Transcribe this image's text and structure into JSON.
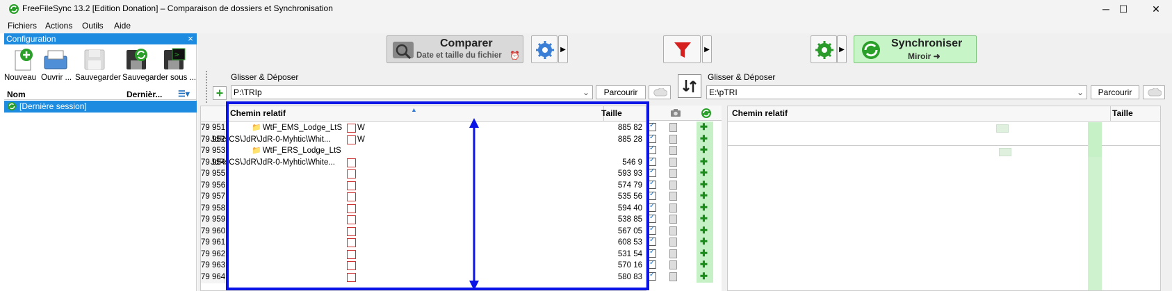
{
  "window": {
    "title": "FreeFileSync 13.2 [Edition Donation] – Comparaison de dossiers et Synchronisation",
    "minimize": "─",
    "maximize": "☐",
    "close": "✕"
  },
  "menu": [
    "Fichiers",
    "Actions",
    "Outils",
    "Aide"
  ],
  "config": {
    "title": "Configuration",
    "close": "×",
    "toolbar": [
      "Nouveau",
      "Ouvrir ...",
      "Sauvegarder",
      "Sauvegarder sous ..."
    ],
    "col_name": "Nom",
    "col_last": "Dernièr...",
    "session": "[Dernière session]"
  },
  "compare": {
    "label": "Comparer",
    "sub": "Date et taille du fichier"
  },
  "sync": {
    "label": "Synchroniser",
    "sub": "Miroir ➜"
  },
  "left": {
    "drop_label": "Glisser & Déposer",
    "path": "P:\\TRIp",
    "browse": "Parcourir"
  },
  "right": {
    "drop_label": "Glisser & Déposer",
    "path": "E:\\pTRI",
    "browse": "Parcourir"
  },
  "grid": {
    "col_path": "Chemin relatif",
    "col_size": "Taille",
    "rows": [
      {
        "num": "79 951",
        "path": "WtF_EMS_Lodge_LtS",
        "name": "W",
        "size": "885 82",
        "folder": true
      },
      {
        "num": "79 952",
        "path": "JdRsCS\\JdR\\JdR-0-Myhtic\\Whit...",
        "name": "W",
        "size": "885 28",
        "folder": false
      },
      {
        "num": "79 953",
        "path": "WtF_ERS_Lodge_LtS",
        "name": "",
        "size": "",
        "folder": true
      },
      {
        "num": "79 954",
        "path": "JdRsCS\\JdR\\JdR-0-Myhtic\\White...",
        "name": "",
        "size": "546 9",
        "folder": false
      },
      {
        "num": "79 955",
        "path": "",
        "name": "",
        "size": "593 93",
        "folder": false
      },
      {
        "num": "79 956",
        "path": "",
        "name": "",
        "size": "574 79",
        "folder": false
      },
      {
        "num": "79 957",
        "path": "",
        "name": "",
        "size": "535 56",
        "folder": false
      },
      {
        "num": "79 958",
        "path": "",
        "name": "",
        "size": "594 40",
        "folder": false
      },
      {
        "num": "79 959",
        "path": "",
        "name": "",
        "size": "538 85",
        "folder": false
      },
      {
        "num": "79 960",
        "path": "",
        "name": "",
        "size": "567 05",
        "folder": false
      },
      {
        "num": "79 961",
        "path": "",
        "name": "",
        "size": "608 53",
        "folder": false
      },
      {
        "num": "79 962",
        "path": "",
        "name": "",
        "size": "531 54",
        "folder": false
      },
      {
        "num": "79 963",
        "path": "",
        "name": "",
        "size": "570 16",
        "folder": false
      },
      {
        "num": "79 964",
        "path": "",
        "name": "",
        "size": "580 83",
        "folder": false
      }
    ],
    "right_col_path": "Chemin relatif",
    "right_col_size": "Taille"
  },
  "colors": {
    "accent": "#1c8be0",
    "highlight": "#0a14e6",
    "sync_green": "#c8f5c8"
  }
}
